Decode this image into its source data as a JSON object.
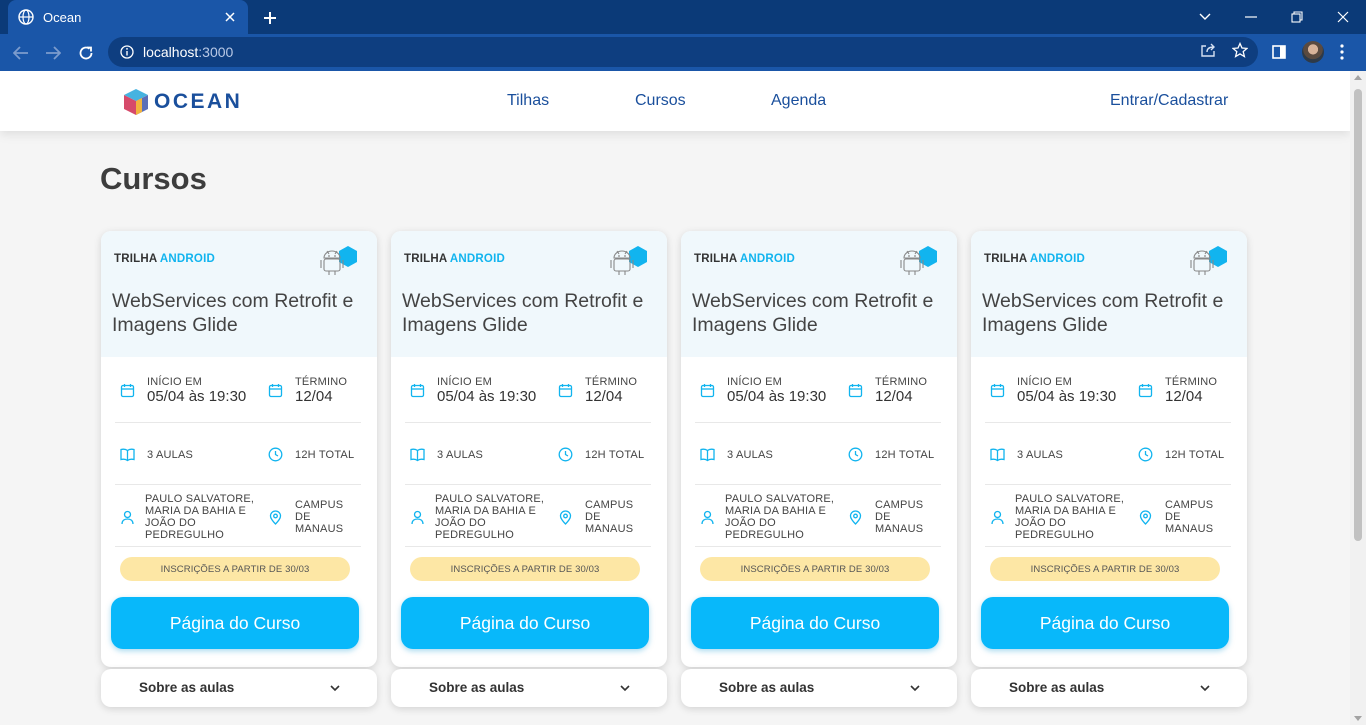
{
  "browser": {
    "tab_title": "Ocean",
    "url_host": "localhost",
    "url_port": ":3000"
  },
  "site": {
    "logo_text": "OCEAN",
    "nav": [
      "Tilhas",
      "Cursos",
      "Agenda"
    ],
    "login": "Entrar/Cadastrar"
  },
  "page": {
    "title": "Cursos"
  },
  "cards": [
    {
      "trilha_prefix": "TRILHA",
      "trilha_name": "ANDROID",
      "title": "WebServices com Retrofit e Imagens Glide",
      "start_label": "INÍCIO EM",
      "start_value": "05/04 às 19:30",
      "end_label": "TÉRMINO",
      "end_value": "12/04",
      "lessons": "3 AULAS",
      "total": "12H TOTAL",
      "instructors": "PAULO SALVATORE, MARIA DA BAHIA E JOÃO DO PEDREGULHO",
      "location": "CAMPUS DE MANAUS",
      "enroll": "INSCRIÇÕES A PARTIR DE 30/03",
      "button": "Página do Curso",
      "about": "Sobre as aulas"
    },
    {
      "trilha_prefix": "TRILHA",
      "trilha_name": "ANDROID",
      "title": "WebServices com Retrofit e Imagens Glide",
      "start_label": "INÍCIO EM",
      "start_value": "05/04 às 19:30",
      "end_label": "TÉRMINO",
      "end_value": "12/04",
      "lessons": "3 AULAS",
      "total": "12H TOTAL",
      "instructors": "PAULO SALVATORE, MARIA DA BAHIA E JOÃO DO PEDREGULHO",
      "location": "CAMPUS DE MANAUS",
      "enroll": "INSCRIÇÕES A PARTIR DE 30/03",
      "button": "Página do Curso",
      "about": "Sobre as aulas"
    },
    {
      "trilha_prefix": "TRILHA",
      "trilha_name": "ANDROID",
      "title": "WebServices com Retrofit e Imagens Glide",
      "start_label": "INÍCIO EM",
      "start_value": "05/04 às 19:30",
      "end_label": "TÉRMINO",
      "end_value": "12/04",
      "lessons": "3 AULAS",
      "total": "12H TOTAL",
      "instructors": "PAULO SALVATORE, MARIA DA BAHIA E JOÃO DO PEDREGULHO",
      "location": "CAMPUS DE MANAUS",
      "enroll": "INSCRIÇÕES A PARTIR DE 30/03",
      "button": "Página do Curso",
      "about": "Sobre as aulas"
    },
    {
      "trilha_prefix": "TRILHA",
      "trilha_name": "ANDROID",
      "title": "WebServices com Retrofit e Imagens Glide",
      "start_label": "INÍCIO EM",
      "start_value": "05/04 às 19:30",
      "end_label": "TÉRMINO",
      "end_value": "12/04",
      "lessons": "3 AULAS",
      "total": "12H TOTAL",
      "instructors": "PAULO SALVATORE, MARIA DA BAHIA E JOÃO DO PEDREGULHO",
      "location": "CAMPUS DE MANAUS",
      "enroll": "INSCRIÇÕES A PARTIR DE 30/03",
      "button": "Página do Curso",
      "about": "Sobre as aulas"
    }
  ],
  "colors": {
    "accent": "#08b8fa",
    "trilha": "#11b4ef",
    "nav_blue": "#1a4f9c",
    "enroll_pill": "#fde7a5",
    "browser_frame": "#0b3a78"
  },
  "icons": {
    "start": "calendar-icon",
    "end": "calendar-icon",
    "lessons": "book-icon",
    "total": "clock-icon",
    "instructors": "person-icon",
    "location": "map-pin-icon",
    "badge": "android-hexagon-icon",
    "about_toggle": "chevron-down-icon"
  }
}
